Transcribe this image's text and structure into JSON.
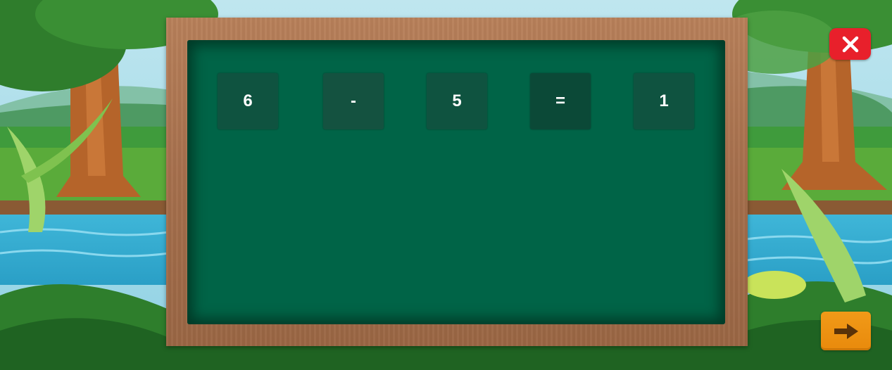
{
  "equation": {
    "tiles": [
      {
        "value": "6",
        "role": "number"
      },
      {
        "value": "-",
        "role": "operator"
      },
      {
        "value": "5",
        "role": "number"
      },
      {
        "value": "=",
        "role": "equals"
      },
      {
        "value": "1",
        "role": "answer"
      }
    ]
  },
  "controls": {
    "close_icon": "close-icon",
    "next_icon": "arrow-right-icon"
  },
  "colors": {
    "board": "#006447",
    "tile": "#0f5340",
    "frame": "#a56f4c",
    "close_button": "#e8202b",
    "next_button": "#ee920f"
  }
}
